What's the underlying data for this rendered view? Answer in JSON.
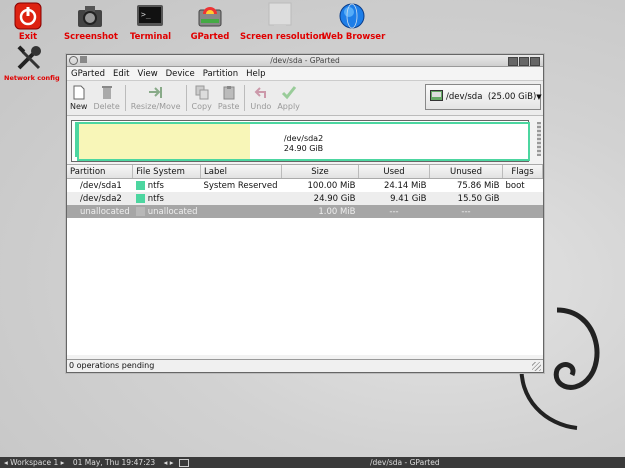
{
  "desktop": {
    "icons": [
      {
        "label": "Exit",
        "name": "exit"
      },
      {
        "label": "Screenshot",
        "name": "screenshot"
      },
      {
        "label": "Terminal",
        "name": "terminal"
      },
      {
        "label": "GParted",
        "name": "gparted"
      },
      {
        "label": "Screen resolution",
        "name": "screen-resolution"
      },
      {
        "label": "Web Browser",
        "name": "web-browser"
      },
      {
        "label": "Network config",
        "name": "network-config"
      }
    ]
  },
  "window": {
    "title": "/dev/sda - GParted",
    "menu": [
      "GParted",
      "Edit",
      "View",
      "Device",
      "Partition",
      "Help"
    ],
    "toolbar": {
      "new": "New",
      "delete": "Delete",
      "resize": "Resize/Move",
      "copy": "Copy",
      "paste": "Paste",
      "undo": "Undo",
      "apply": "Apply"
    },
    "device": "/dev/sda  (25.00 GiB)",
    "diskmap": {
      "name": "/dev/sda2",
      "size": "24.90 GiB",
      "used_fraction": 0.38
    },
    "columns": [
      "Partition",
      "File System",
      "Label",
      "Size",
      "Used",
      "Unused",
      "Flags"
    ],
    "rows": [
      {
        "partition": "/dev/sda1",
        "fs": "ntfs",
        "label": "System Reserved",
        "size": "100.00 MiB",
        "used": "24.14 MiB",
        "unused": "75.86 MiB",
        "flags": "boot",
        "fs_color": "#4cd6a0"
      },
      {
        "partition": "/dev/sda2",
        "fs": "ntfs",
        "label": "",
        "size": "24.90 GiB",
        "used": "9.41 GiB",
        "unused": "15.50 GiB",
        "flags": "",
        "fs_color": "#4cd6a0"
      },
      {
        "partition": "unallocated",
        "fs": "unallocated",
        "label": "",
        "size": "1.00 MiB",
        "used": "---",
        "unused": "---",
        "flags": "",
        "fs_color": "#b8b8b8"
      }
    ],
    "status": "0 operations pending"
  },
  "taskbar": {
    "workspace": "◂ Workspace 1 ▸",
    "clock": "01 May, Thu 19:47:23",
    "task": "/dev/sda - GParted"
  }
}
